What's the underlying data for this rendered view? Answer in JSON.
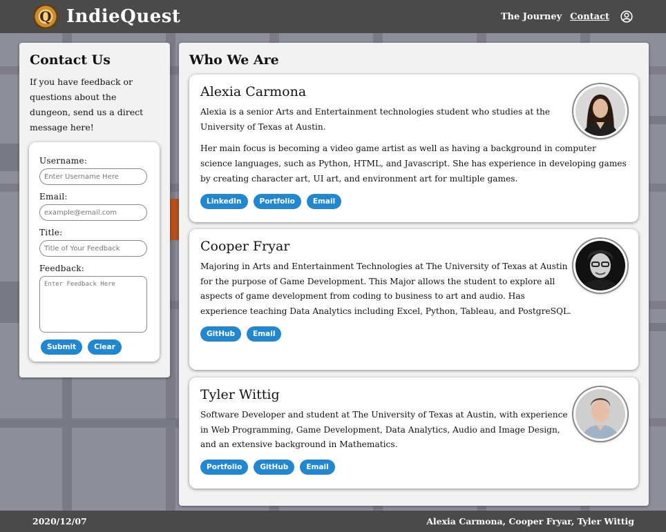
{
  "header": {
    "brand": "IndieQuest",
    "logo_letter": "Q",
    "nav": [
      {
        "label": "The Journey"
      },
      {
        "label": "Contact"
      }
    ]
  },
  "contact": {
    "title": "Contact Us",
    "intro": "If you have feedback or questions about the dungeon, send us a direct message here!",
    "username_label": "Username:",
    "username_placeholder": "Enter Username Here",
    "email_label": "Email:",
    "email_placeholder": "example@email.com",
    "title_label": "Title:",
    "title_placeholder": "Title of Your Feedback",
    "feedback_label": "Feedback:",
    "feedback_placeholder": "Enter Feedback Here",
    "submit_label": "Submit",
    "clear_label": "Clear"
  },
  "who": {
    "title": "Who We Are",
    "people": [
      {
        "name": "Alexia Carmona",
        "p1": "Alexia is a senior Arts and Entertainment technologies student who studies at the University of Texas at Austin.",
        "p2": "Her main focus is becoming a video game artist as well as having a background in computer science languages, such as Python, HTML, and Javascript. She has experience in developing games by creating character art, UI art, and environment art for multiple games.",
        "links": [
          "LinkedIn",
          "Portfolio",
          "Email"
        ]
      },
      {
        "name": "Cooper Fryar",
        "p1": "Majoring in Arts and Entertainment Technologies at The University of Texas at Austin for the purpose of Game Development. This Major allows the student to explore all aspects of game development from coding to business to art and audio. Has experience teaching Data Analytics including Excel, Python, Tableau, and PostgreSQL.",
        "links": [
          "GitHub",
          "Email"
        ]
      },
      {
        "name": "Tyler Wittig",
        "p1": "Software Developer and student at The University of Texas at Austin, with experience in Web Programming, Game Development, Data Analytics, Audio and Image Design, and an extensive background in Mathematics.",
        "links": [
          "Portfolio",
          "GitHub",
          "Email"
        ]
      }
    ]
  },
  "footer": {
    "date": "2020/12/07",
    "authors": "Alexia Carmona, Cooper Fryar, Tyler Wittig"
  },
  "colors": {
    "accent": "#2187d0",
    "header_bg": "#4a4a4a"
  }
}
